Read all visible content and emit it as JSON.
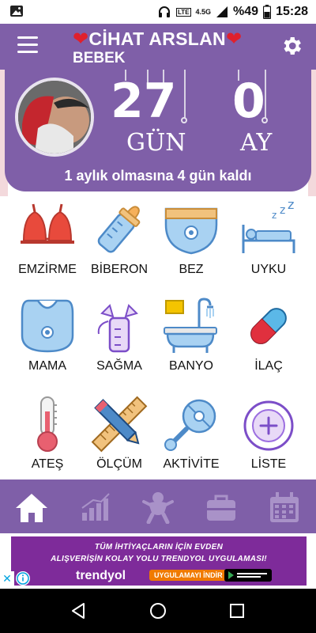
{
  "status_bar": {
    "network": "4.5G",
    "lte": "LTE",
    "battery": "%49",
    "time": "15:28"
  },
  "header": {
    "title": "CİHAT ARSLAN",
    "subtitle": "BEBEK",
    "heart_color": "#e0202c"
  },
  "card": {
    "days_value": "27",
    "days_label": "GÜN",
    "months_value": "0",
    "months_label": "AY",
    "message": "1 aylık olmasına 4 gün kaldı"
  },
  "grid": {
    "items": [
      {
        "label": "EMZİRME",
        "icon": "bra-icon"
      },
      {
        "label": "BİBERON",
        "icon": "bottle-icon"
      },
      {
        "label": "BEZ",
        "icon": "diaper-icon"
      },
      {
        "label": "UYKU",
        "icon": "sleep-icon"
      },
      {
        "label": "MAMA",
        "icon": "bib-icon"
      },
      {
        "label": "SAĞMA",
        "icon": "breast-pump-icon"
      },
      {
        "label": "BANYO",
        "icon": "bathtub-icon"
      },
      {
        "label": "İLAÇ",
        "icon": "pill-icon"
      },
      {
        "label": "ATEŞ",
        "icon": "thermometer-icon"
      },
      {
        "label": "ÖLÇÜM",
        "icon": "ruler-pencil-icon"
      },
      {
        "label": "AKTİVİTE",
        "icon": "rattle-icon"
      },
      {
        "label": "LİSTE",
        "icon": "add-circle-icon"
      }
    ]
  },
  "bottom_nav": {
    "items": [
      "home-icon",
      "stats-icon",
      "baby-icon",
      "medical-bag-icon",
      "calendar-icon"
    ],
    "active": "home-icon"
  },
  "ad": {
    "line1": "TÜM İHTİYAÇLARIN İÇİN EVDEN",
    "line2": "ALIŞVERİŞİN KOLAY YOLU TRENDYOL UYGULAMASI!",
    "brand": "trendyol",
    "cta": "UYGULAMAYI İNDİR",
    "close": "✕"
  },
  "colors": {
    "primary": "#7f5fa8",
    "ad_background": "#7e2b9a"
  }
}
